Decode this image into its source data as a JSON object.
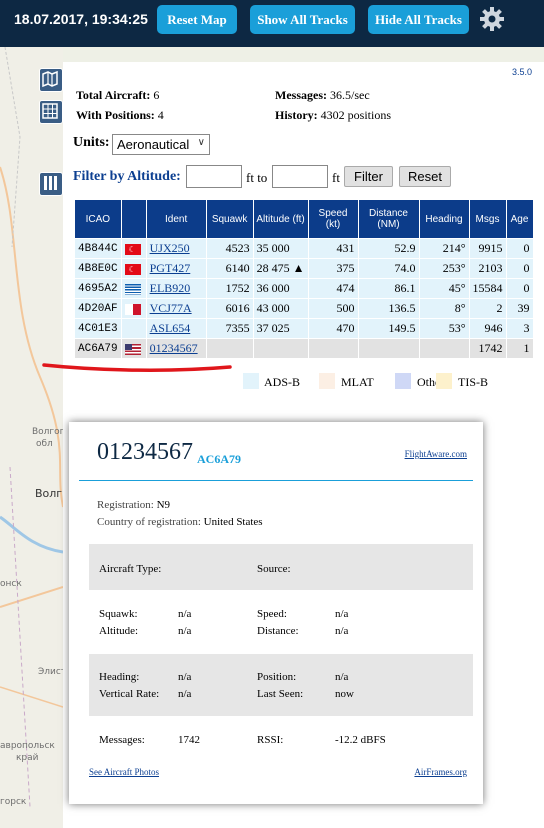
{
  "topbar": {
    "datetime": "18.07.2017, 19:34:25",
    "buttons": [
      "Reset Map",
      "Show All Tracks",
      "Hide All Tracks"
    ],
    "settings_icon": "gear-icon"
  },
  "map": {
    "labels": [
      "Волгог",
      "обл",
      "Волг",
      "онск",
      "Элист",
      "авропольск",
      "край",
      "горск"
    ]
  },
  "version": "3.5.0",
  "stats": {
    "total_label": "Total Aircraft:",
    "total_value": "6",
    "withpos_label": "With Positions:",
    "withpos_value": "4",
    "messages_label": "Messages:",
    "messages_value": "36.5/sec",
    "history_label": "History:",
    "history_value": "4302 positions"
  },
  "units": {
    "label": "Units:",
    "selected": "Aeronautical"
  },
  "filter": {
    "label": "Filter by Altitude:",
    "from_value": "",
    "to_text": "ft to",
    "ft_text": "ft",
    "to_value": "",
    "filter_button": "Filter",
    "reset_button": "Reset"
  },
  "table": {
    "headers": [
      "ICAO",
      "",
      "Ident",
      "Squawk",
      "Altitude (ft)",
      "Speed (kt)",
      "Distance (NM)",
      "Heading",
      "Msgs",
      "Age"
    ],
    "rows": [
      {
        "icao": "4B844C",
        "flag": "tr",
        "ident": "UJX250",
        "squawk": "4523",
        "altitude": "35 000",
        "speed": "431",
        "distance": "52.9",
        "heading": "214°",
        "msgs": "9915",
        "age": "0",
        "type": "adsb"
      },
      {
        "icao": "4B8E0C",
        "flag": "tr",
        "ident": "PGT427",
        "squawk": "6140",
        "altitude": "28 475 ▲",
        "speed": "375",
        "distance": "74.0",
        "heading": "253°",
        "msgs": "2103",
        "age": "0",
        "type": "adsb"
      },
      {
        "icao": "4695A2",
        "flag": "gr",
        "ident": "ELB920",
        "squawk": "1752",
        "altitude": "36 000",
        "speed": "474",
        "distance": "86.1",
        "heading": "45°",
        "msgs": "15584",
        "age": "0",
        "type": "adsb"
      },
      {
        "icao": "4D20AF",
        "flag": "mt",
        "ident": "VCJ77A",
        "squawk": "6016",
        "altitude": "43 000",
        "speed": "500",
        "distance": "136.5",
        "heading": "8°",
        "msgs": "2",
        "age": "39",
        "type": "adsb"
      },
      {
        "icao": "4C01E3",
        "flag": "",
        "ident": "ASL654",
        "squawk": "7355",
        "altitude": "37 025",
        "speed": "470",
        "distance": "149.5",
        "heading": "53°",
        "msgs": "946",
        "age": "3",
        "type": "adsb"
      },
      {
        "icao": "AC6A79",
        "flag": "us",
        "ident": "01234567",
        "squawk": "",
        "altitude": "",
        "speed": "",
        "distance": "",
        "heading": "",
        "msgs": "1742",
        "age": "1",
        "type": "other"
      }
    ]
  },
  "legend": [
    {
      "label": "ADS-B",
      "color": "#e2f3fb"
    },
    {
      "label": "MLAT",
      "color": "#fcefe4"
    },
    {
      "label": "Other",
      "color": "#cfd8f6"
    },
    {
      "label": "TIS-B",
      "color": "#fdf1cc"
    }
  ],
  "card": {
    "ident": "01234567",
    "icao": "AC6A79",
    "flightaware": "FlightAware.com",
    "registration_label": "Registration:",
    "registration_value": "N9",
    "country_label": "Country of registration:",
    "country_value": "United States",
    "aircraft_type_label": "Aircraft Type:",
    "aircraft_type_value": "",
    "source_label": "Source:",
    "source_value": "",
    "squawk_label": "Squawk:",
    "squawk_value": "n/a",
    "altitude_label": "Altitude:",
    "altitude_value": "n/a",
    "speed_label": "Speed:",
    "speed_value": "n/a",
    "distance_label": "Distance:",
    "distance_value": "n/a",
    "heading_label": "Heading:",
    "heading_value": "n/a",
    "vrate_label": "Vertical Rate:",
    "vrate_value": "n/a",
    "position_label": "Position:",
    "position_value": "n/a",
    "lastseen_label": "Last Seen:",
    "lastseen_value": "now",
    "messages_label": "Messages:",
    "messages_value": "1742",
    "rssi_label": "RSSI:",
    "rssi_value": "-12.2 dBFS",
    "photos_link": "See Aircraft Photos",
    "airframes_link": "AirFrames.org"
  }
}
